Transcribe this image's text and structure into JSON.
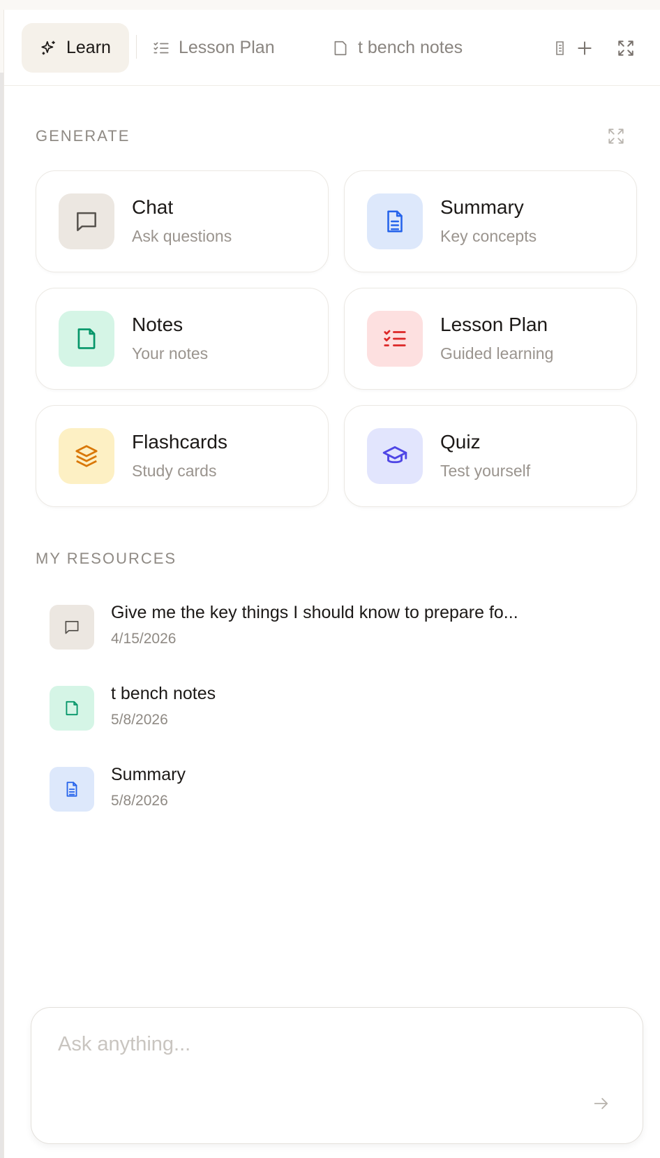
{
  "tabs": [
    {
      "label": "Learn",
      "icon": "sparkles-icon",
      "active": true
    },
    {
      "label": "Lesson Plan",
      "icon": "list-check-icon",
      "active": false
    },
    {
      "label": "t bench notes",
      "icon": "note-icon",
      "active": false
    }
  ],
  "generate": {
    "label": "GENERATE",
    "cards": [
      {
        "title": "Chat",
        "subtitle": "Ask questions",
        "icon": "chat-bubble-icon",
        "bg": "#ece7e1",
        "fg": "#57534e"
      },
      {
        "title": "Summary",
        "subtitle": "Key concepts",
        "icon": "document-icon",
        "bg": "#dde8fb",
        "fg": "#2563eb"
      },
      {
        "title": "Notes",
        "subtitle": "Your notes",
        "icon": "note-icon",
        "bg": "#d5f5e6",
        "fg": "#059669"
      },
      {
        "title": "Lesson Plan",
        "subtitle": "Guided learning",
        "icon": "list-check-icon",
        "bg": "#fde0e0",
        "fg": "#dc2626"
      },
      {
        "title": "Flashcards",
        "subtitle": "Study cards",
        "icon": "layers-icon",
        "bg": "#fdf0c4",
        "fg": "#d97706"
      },
      {
        "title": "Quiz",
        "subtitle": "Test yourself",
        "icon": "graduation-cap-icon",
        "bg": "#e2e5fd",
        "fg": "#4f46e5"
      }
    ]
  },
  "resources": {
    "label": "MY RESOURCES",
    "items": [
      {
        "title": "Give me the key things I should know to prepare fo...",
        "date": "4/15/2026",
        "icon": "chat-bubble-icon",
        "bg": "#ece7e1",
        "fg": "#57534e"
      },
      {
        "title": "t bench notes",
        "date": "5/8/2026",
        "icon": "note-icon",
        "bg": "#d5f5e6",
        "fg": "#059669"
      },
      {
        "title": "Summary",
        "date": "5/8/2026",
        "icon": "document-icon",
        "bg": "#dde8fb",
        "fg": "#2563eb"
      }
    ]
  },
  "composer": {
    "placeholder": "Ask anything...",
    "value": ""
  }
}
